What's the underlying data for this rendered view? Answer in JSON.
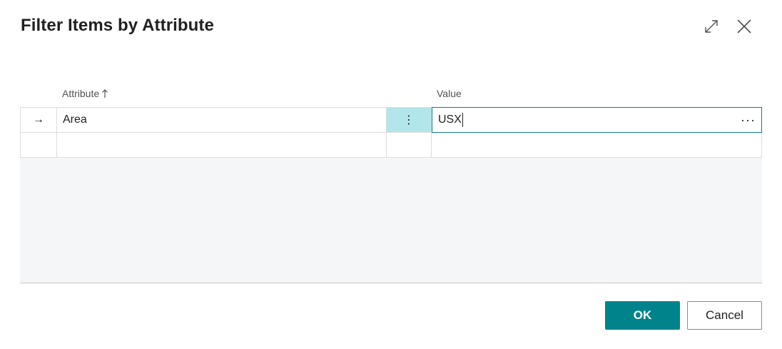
{
  "dialog": {
    "title": "Filter Items by Attribute",
    "expand_icon": "expand-diagonal-icon",
    "close_icon": "close-icon"
  },
  "grid": {
    "columns": {
      "attribute": "Attribute",
      "attribute_sort": "ascending",
      "value": "Value"
    },
    "rows": [
      {
        "indicator": "→",
        "attribute": "Area",
        "value": "USX",
        "menu": "⋮",
        "lookup": "···"
      },
      {
        "indicator": "",
        "attribute": "",
        "value": "",
        "menu": "",
        "lookup": ""
      }
    ]
  },
  "footer": {
    "ok_label": "OK",
    "cancel_label": "Cancel"
  },
  "colors": {
    "accent": "#00838a",
    "active_cell": "#b3e6ec",
    "focus_border": "#0f7b83"
  }
}
